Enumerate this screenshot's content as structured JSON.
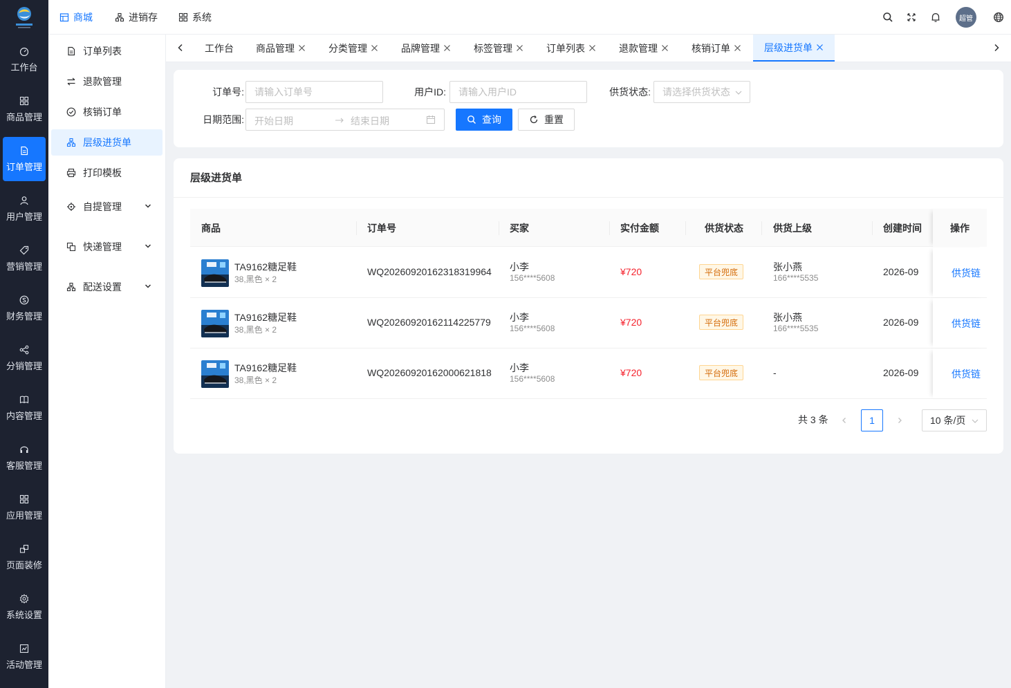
{
  "brand": {
    "logo_text": "SHUCUE"
  },
  "rail": {
    "items": [
      {
        "label": "工作台",
        "icon": "dashboard-icon",
        "active": false
      },
      {
        "label": "商品管理",
        "icon": "grid-icon",
        "active": false
      },
      {
        "label": "订单管理",
        "icon": "file-icon",
        "active": true
      },
      {
        "label": "用户管理",
        "icon": "user-icon",
        "active": false
      },
      {
        "label": "营销管理",
        "icon": "tag-icon",
        "active": false
      },
      {
        "label": "财务管理",
        "icon": "dollar-icon",
        "active": false
      },
      {
        "label": "分销管理",
        "icon": "share-icon",
        "active": false
      },
      {
        "label": "内容管理",
        "icon": "book-icon",
        "active": false
      },
      {
        "label": "客服管理",
        "icon": "headset-icon",
        "active": false
      },
      {
        "label": "应用管理",
        "icon": "apps-icon",
        "active": false
      },
      {
        "label": "页面装修",
        "icon": "layout-icon",
        "active": false
      },
      {
        "label": "系统设置",
        "icon": "gear-icon",
        "active": false
      },
      {
        "label": "活动管理",
        "icon": "activity-icon",
        "active": false
      }
    ]
  },
  "topnav": {
    "items": [
      {
        "label": "商城",
        "icon": "shop-icon",
        "active": true
      },
      {
        "label": "进销存",
        "icon": "inventory-icon",
        "active": false
      },
      {
        "label": "系统",
        "icon": "system-icon",
        "active": false
      }
    ],
    "avatar_text": "超管"
  },
  "submenu": {
    "items": [
      {
        "label": "订单列表",
        "icon": "document-icon",
        "active": false,
        "has_arrow": false
      },
      {
        "label": "退款管理",
        "icon": "swap-icon",
        "active": false,
        "has_arrow": false
      },
      {
        "label": "核销订单",
        "icon": "check-circle-icon",
        "active": false,
        "has_arrow": false
      },
      {
        "label": "层级进货单",
        "icon": "hierarchy-icon",
        "active": true,
        "has_arrow": false
      },
      {
        "label": "打印模板",
        "icon": "printer-icon",
        "active": false,
        "has_arrow": false
      },
      {
        "label": "自提管理",
        "icon": "location-icon",
        "active": false,
        "has_arrow": true
      },
      {
        "label": "快递管理",
        "icon": "package-icon",
        "active": false,
        "has_arrow": true
      },
      {
        "label": "配送设置",
        "icon": "delivery-icon",
        "active": false,
        "has_arrow": true
      }
    ]
  },
  "tabs": [
    {
      "label": "工作台",
      "closable": false,
      "active": false
    },
    {
      "label": "商品管理",
      "closable": true,
      "active": false
    },
    {
      "label": "分类管理",
      "closable": true,
      "active": false
    },
    {
      "label": "品牌管理",
      "closable": true,
      "active": false
    },
    {
      "label": "标签管理",
      "closable": true,
      "active": false
    },
    {
      "label": "订单列表",
      "closable": true,
      "active": false
    },
    {
      "label": "退款管理",
      "closable": true,
      "active": false
    },
    {
      "label": "核销订单",
      "closable": true,
      "active": false
    },
    {
      "label": "层级进货单",
      "closable": true,
      "active": true
    }
  ],
  "search": {
    "order_no_label": "订单号:",
    "order_no_placeholder": "请输入订单号",
    "user_id_label": "用户ID:",
    "user_id_placeholder": "请输入用户ID",
    "supply_status_label": "供货状态:",
    "supply_status_placeholder": "请选择供货状态",
    "date_range_label": "日期范围:",
    "start_placeholder": "开始日期",
    "end_placeholder": "结束日期",
    "search_button": "查询",
    "reset_button": "重置"
  },
  "table": {
    "title": "层级进货单",
    "columns": [
      "商品",
      "订单号",
      "买家",
      "实付金额",
      "供货状态",
      "供货上级",
      "创建时间",
      "操作"
    ],
    "rows": [
      {
        "product_name": "TA9162糖足鞋",
        "product_spec": "38,黑色 × 2",
        "product_img_text": "TA9162 糖足鞋",
        "order_no": "WQ20260920162318319964",
        "buyer_name": "小李",
        "buyer_phone": "156****5608",
        "amount": "¥720",
        "status": "平台兜底",
        "supplier_name": "张小燕",
        "supplier_phone": "166****5535",
        "created": "2026-09",
        "action": "供货链"
      },
      {
        "product_name": "TA9162糖足鞋",
        "product_spec": "38,黑色 × 2",
        "product_img_text": "TA9162 糖足鞋",
        "order_no": "WQ20260920162114225779",
        "buyer_name": "小李",
        "buyer_phone": "156****5608",
        "amount": "¥720",
        "status": "平台兜底",
        "supplier_name": "张小燕",
        "supplier_phone": "166****5535",
        "created": "2026-09",
        "action": "供货链"
      },
      {
        "product_name": "TA9162糖足鞋",
        "product_spec": "38,黑色 × 2",
        "product_img_text": "TA9162 糖足鞋",
        "order_no": "WQ20260920162000621818",
        "buyer_name": "小李",
        "buyer_phone": "156****5608",
        "amount": "¥720",
        "status": "平台兜底",
        "supplier_name": "-",
        "supplier_phone": "",
        "created": "2026-09",
        "action": "供货链"
      }
    ]
  },
  "pagination": {
    "total_text": "共 3 条",
    "current_page": "1",
    "page_size": "10 条/页"
  },
  "colors": {
    "primary": "#1677ff",
    "rail_bg": "#1d2230",
    "price": "#f5222d",
    "status_tag": "#d46b08"
  }
}
